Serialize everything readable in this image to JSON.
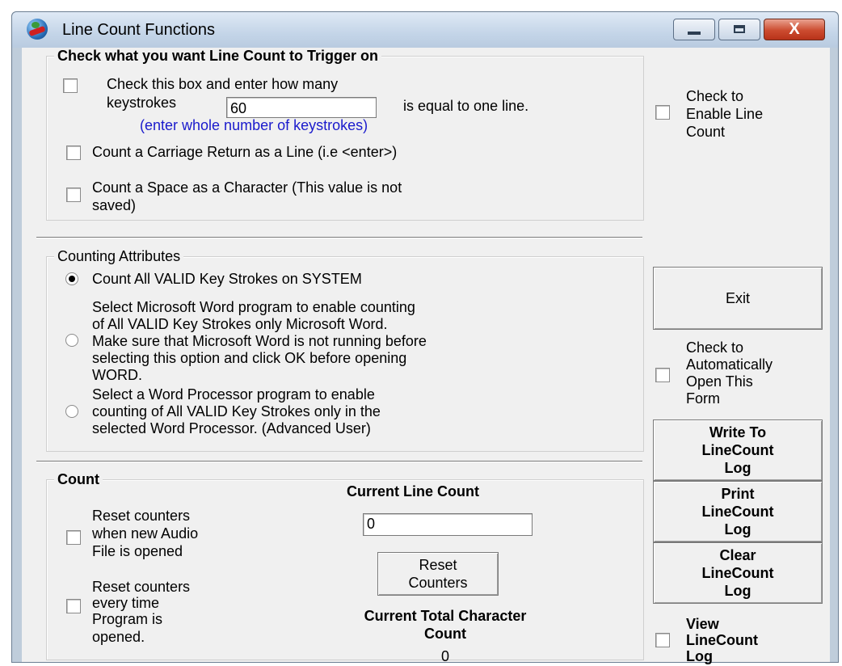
{
  "window": {
    "title": "Line Count Functions",
    "close_glyph": "X"
  },
  "trigger_group": {
    "legend": "Check what you want Line Count to Trigger on",
    "keystroke_line1": "Check this box and enter how many",
    "keystroke_prefix": "keystrokes",
    "keystroke_value": "60",
    "keystroke_suffix": "is equal to one line.",
    "keystroke_hint": "(enter whole number of keystrokes)",
    "carriage_return": "Count a Carriage Return as a Line (i.e <enter>)",
    "space_line1": "Count a Space as a Character (This value is not",
    "space_line2": "saved)"
  },
  "enable": {
    "line1": "Check to",
    "line2": "Enable Line",
    "line3": "Count"
  },
  "attributes_group": {
    "legend": "Counting Attributes",
    "option_system": "Count All VALID Key Strokes on SYSTEM",
    "option_word_lines": [
      "Select Microsoft Word program to enable counting",
      "of All VALID Key Strokes only Microsoft Word.",
      "Make sure that Microsoft Word is not running before",
      "selecting this option and click OK before opening",
      "WORD."
    ],
    "option_wp_lines": [
      "Select a Word Processor program to enable",
      "counting of All VALID Key Strokes only in the",
      "selected Word Processor. (Advanced User)"
    ],
    "selected_option": "system"
  },
  "side": {
    "exit_label": "Exit",
    "auto_open_lines": [
      "Check to",
      "Automatically",
      "Open This",
      "Form"
    ],
    "write_log_lines": [
      "Write To",
      "LineCount",
      "Log"
    ],
    "print_log_lines": [
      "Print",
      "LineCount",
      "Log"
    ],
    "clear_log_lines": [
      "Clear",
      "LineCount",
      "Log"
    ],
    "view_log_lines": [
      "View",
      "LineCount",
      "Log"
    ]
  },
  "count_group": {
    "legend": "Count",
    "current_line_count_label": "Current Line Count",
    "current_line_count_value": "0",
    "reset_audio_lines": [
      "Reset counters",
      "when new Audio",
      "File is opened"
    ],
    "reset_program_lines": [
      "Reset counters",
      "every time",
      "Program is",
      "opened."
    ],
    "reset_button_lines": [
      "Reset",
      "Counters"
    ],
    "total_char_label_lines": [
      "Current Total Character",
      "Count"
    ],
    "total_char_value": "0"
  }
}
